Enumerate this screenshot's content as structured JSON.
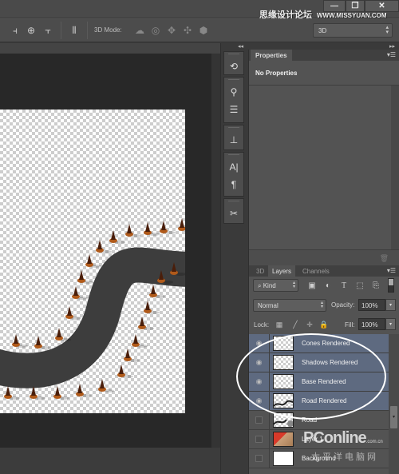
{
  "window": {
    "watermark_cn": "思缘设计论坛",
    "watermark_url": "WWW.MISSYUAN.COM",
    "controls": {
      "minimize": "—",
      "restore": "❐",
      "close": "✕"
    }
  },
  "options_bar": {
    "align_icons": [
      "align-left-icon",
      "align-center-icon",
      "align-right-icon",
      "distribute-icon"
    ],
    "mode_label": "3D Mode:",
    "mode_icons": [
      "rotate-3d-icon",
      "roll-3d-icon",
      "drag-3d-icon",
      "slide-3d-icon",
      "scale-3d-icon"
    ],
    "workspace_select": "3D"
  },
  "dock": {
    "collapse_left": "◂◂",
    "collapse_right": "▸▸",
    "icons": [
      "history-icon",
      "brushes-icon",
      "adjust-icon",
      "clone-source-icon",
      "character-icon",
      "paragraph-icon",
      "tools-icon"
    ]
  },
  "properties_panel": {
    "tab": "Properties",
    "empty_text": "No Properties"
  },
  "layers_panel": {
    "tabs": [
      "3D",
      "Layers",
      "Channels"
    ],
    "active_tab": "Layers",
    "filter": "Kind",
    "blend_mode": "Normal",
    "opacity_label": "Opacity:",
    "opacity_value": "100%",
    "lock_label": "Lock:",
    "fill_label": "Fill:",
    "fill_value": "100%",
    "layers": [
      {
        "name": "Cones Rendered",
        "visible": true,
        "selected": true
      },
      {
        "name": "Shadows Rendered",
        "visible": true,
        "selected": true
      },
      {
        "name": "Base Rendered",
        "visible": true,
        "selected": true
      },
      {
        "name": "Road Rendered",
        "visible": true,
        "selected": true
      },
      {
        "name": "Road",
        "visible": false,
        "selected": false
      },
      {
        "name": "Layer 1",
        "visible": false,
        "selected": false
      },
      {
        "name": "Background",
        "visible": false,
        "selected": false
      }
    ]
  },
  "overlay": {
    "brand": "PConline",
    "brand_suffix": ".com.cn",
    "brand_cn": "太平洋电脑网"
  }
}
